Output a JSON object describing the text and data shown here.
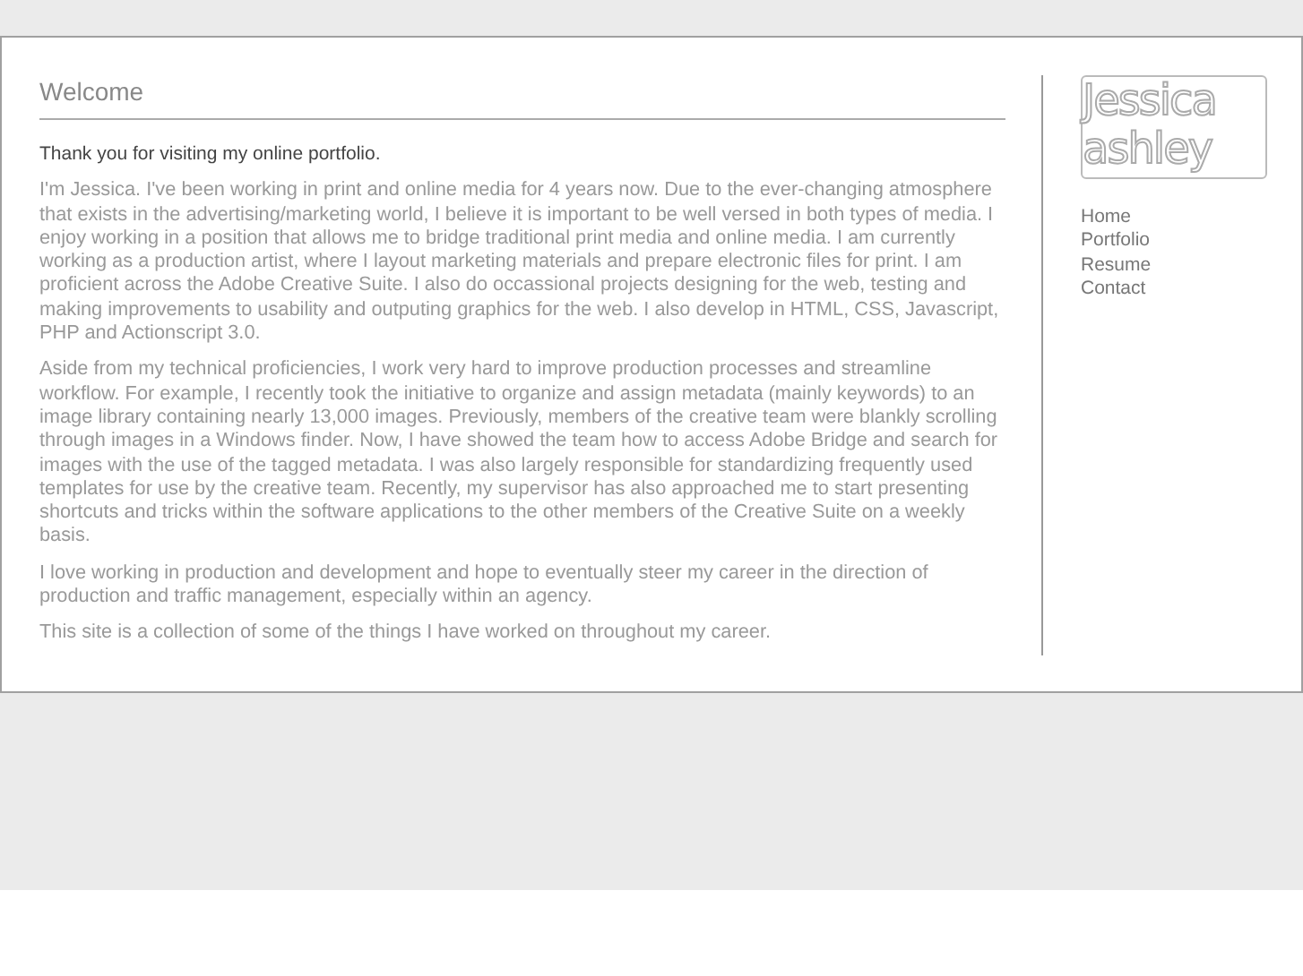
{
  "heading": "Welcome",
  "intro": "Thank you for visiting my online portfolio.",
  "paragraphs": [
    "I'm Jessica. I've been working in print and online media for 4 years now. Due to the ever-changing atmosphere that exists in the advertising/marketing world, I believe it is important to be well versed in both types of media. I enjoy working in a position that allows me to bridge traditional print media and online media. I am currently working as a production artist, where I layout marketing materials and prepare electronic files for print. I am proficient across the Adobe Creative Suite. I also do occassional projects designing for the web, testing and making improvements to usability and outputing graphics for the web. I also develop in HTML, CSS, Javascript, PHP and Actionscript 3.0.",
    "Aside from my technical proficiencies, I work very hard to improve production processes and streamline workflow. For example, I recently took the initiative to organize and assign metadata (mainly keywords) to an image library containing nearly 13,000 images. Previously, members of the creative team were blankly scrolling through images in a Windows finder. Now, I have showed the team how to access Adobe Bridge and search for images with the use of the tagged metadata. I was also largely responsible for standardizing frequently used templates for use by the creative team. Recently, my supervisor has also approached me to start presenting shortcuts and tricks within the software applications to the other members of the Creative Suite on a weekly basis.",
    "I love working in production and development and hope to eventually steer my career in the direction of production and traffic management, especially within an agency.",
    "This site is a collection of some of the things I have worked on throughout my career."
  ],
  "logo": [
    "Jessica",
    "ashley"
  ],
  "nav": [
    "Home",
    "Portfolio",
    "Resume",
    "Contact"
  ]
}
